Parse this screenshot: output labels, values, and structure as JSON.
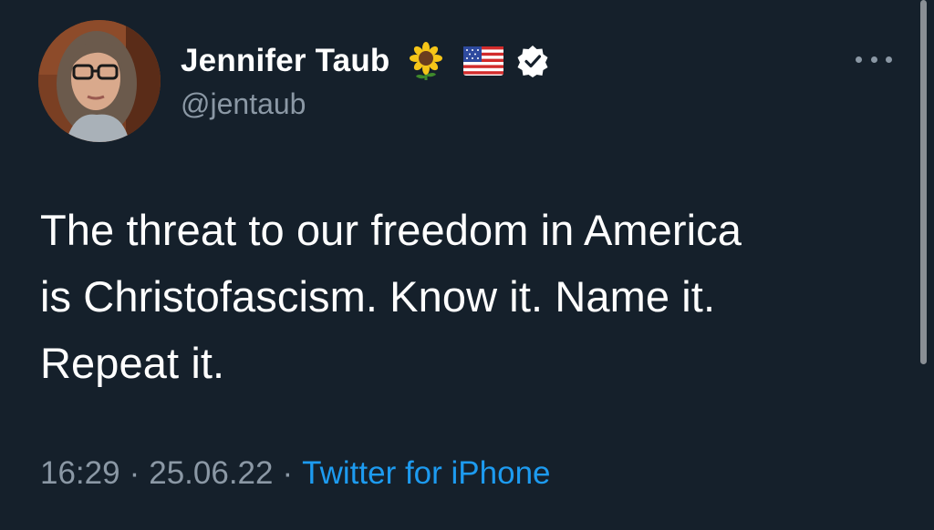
{
  "tweet": {
    "author": {
      "display_name": "Jennifer Taub",
      "handle": "@jentaub",
      "name_emojis": [
        "sunflower-icon",
        "us-flag-icon"
      ],
      "verified": true
    },
    "text_lines": [
      "The threat to our freedom in America",
      "is Christofascism. Know it. Name it.",
      "Repeat it."
    ],
    "meta": {
      "time": "16:29",
      "separator": "·",
      "date": "25.06.22",
      "source": "Twitter for iPhone"
    }
  },
  "colors": {
    "background": "#15202b",
    "primary_text": "#ffffff",
    "secondary_text": "#8b98a5",
    "link": "#1d9bf0"
  }
}
